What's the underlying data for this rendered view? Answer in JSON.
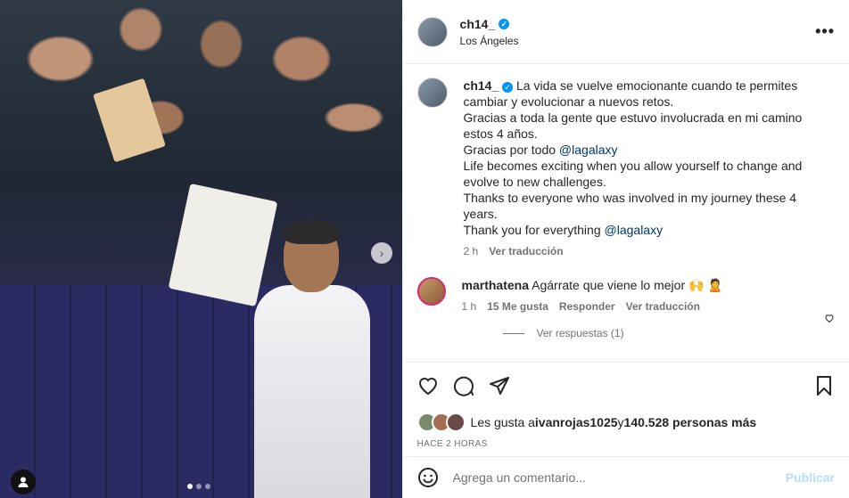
{
  "post": {
    "username": "ch14_",
    "location": "Los Ángeles",
    "more_label": "•••",
    "caption": {
      "line1": "La vida se vuelve emocionante cuando te permites cambiar y evolucionar a nuevos retos.",
      "line2": "Gracias a toda la gente que estuvo involucrada en mi camino estos 4 años.",
      "line3_prefix": "Gracias por todo ",
      "mention1": "@lagalaxy",
      "line4": "Life becomes exciting when you allow yourself to change and evolve to new challenges.",
      "line5": "Thanks to everyone who was involved in my journey these 4 years.",
      "line6_prefix": "Thank you for everything ",
      "mention2": "@lagalaxy"
    },
    "caption_time": "2 h",
    "caption_translate": "Ver traducción",
    "comment": {
      "username": "marthatena",
      "text": "Agárrate que viene lo mejor 🙌 🙎",
      "time": "1 h",
      "likes": "15 Me gusta",
      "reply": "Responder",
      "translate": "Ver traducción",
      "view_replies": "Ver respuestas (1)"
    },
    "likes": {
      "prefix": "Les gusta a ",
      "user": "ivanrojas1025",
      "middle": " y ",
      "count": "140.528 personas más"
    },
    "timestamp": "HACE 2 HORAS",
    "add_comment_placeholder": "Agrega un comentario...",
    "publish_label": "Publicar"
  },
  "media": {
    "carousel_total": 3,
    "carousel_index": 1
  },
  "colors": {
    "verified": "#0095f6",
    "link": "#00376b",
    "publish_disabled": "#b2dffc"
  }
}
